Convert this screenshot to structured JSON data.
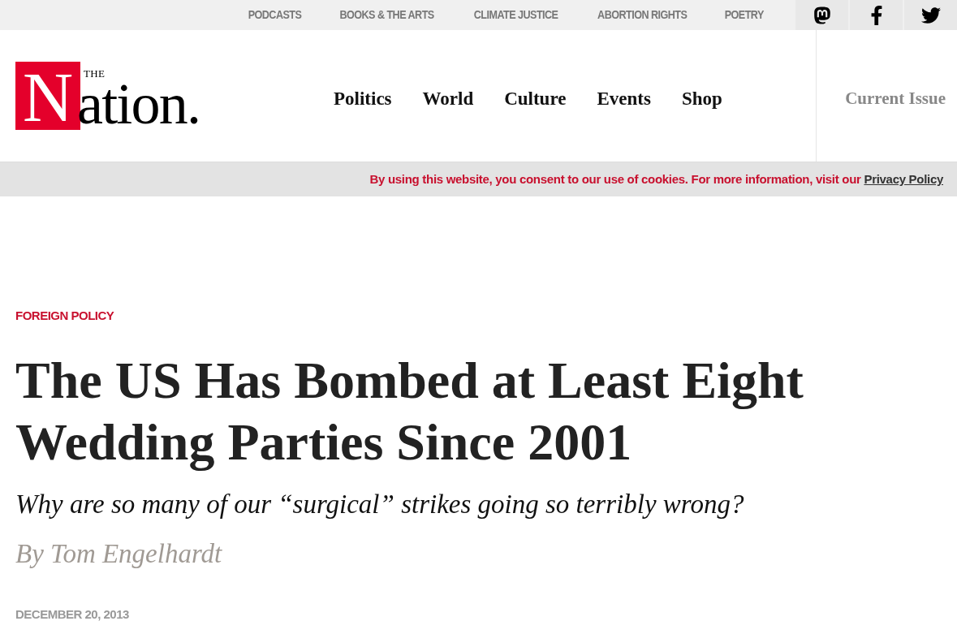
{
  "top_nav": [
    "PODCASTS",
    "BOOKS & THE ARTS",
    "CLIMATE JUSTICE",
    "ABORTION RIGHTS",
    "POETRY"
  ],
  "social": [
    {
      "kind": "mastodon"
    },
    {
      "kind": "facebook"
    },
    {
      "kind": "twitter"
    }
  ],
  "logo": {
    "small": "THE",
    "initial": "N",
    "rest": "ation."
  },
  "main_nav": [
    "Politics",
    "World",
    "Culture",
    "Events",
    "Shop"
  ],
  "current_issue": "Current Issue",
  "cookie_notice": {
    "text": "By using this website, you consent to our use of cookies. For more information, visit our",
    "link": "Privacy Policy"
  },
  "article": {
    "category": "FOREIGN POLICY",
    "headline": "The US Has Bombed at Least Eight Wedding Parties Since 2001",
    "dek": "Why are so many of our “surgical” strikes going so terribly wrong?",
    "byline": "By Tom Engelhardt",
    "date": "DECEMBER 20, 2013"
  }
}
